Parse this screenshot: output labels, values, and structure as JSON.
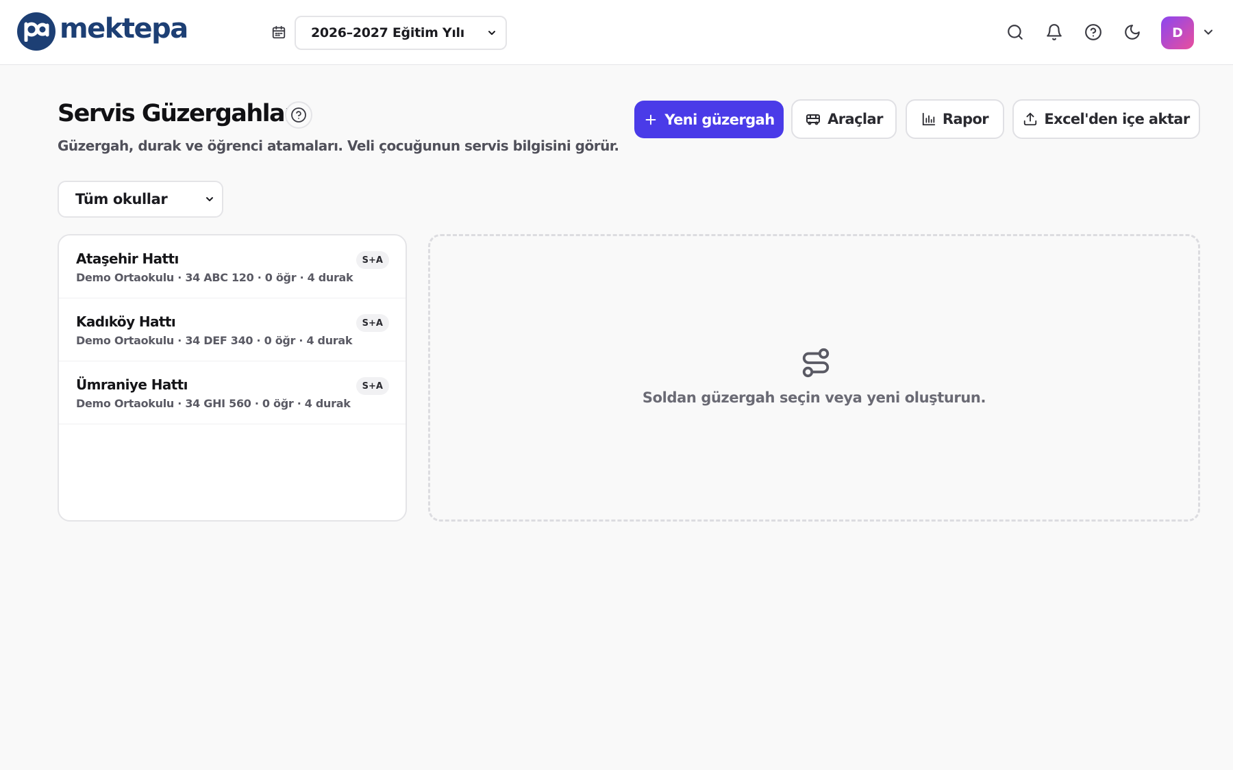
{
  "app": {
    "logo_text": "mektepa"
  },
  "topbar": {
    "year_select_value": "2026–2027 Eğitim Yılı",
    "avatar_initial": "D"
  },
  "header": {
    "title": "Servis Güzergahları",
    "subtitle": "Güzergah, durak ve öğrenci atamaları. Veli çocuğunun servis bilgisini görür.",
    "actions": {
      "new_route": "Yeni güzergah",
      "vehicles": "Araçlar",
      "report": "Rapor",
      "import_excel": "Excel'den içe aktar"
    }
  },
  "filters": {
    "school_select_value": "Tüm okullar"
  },
  "routes": [
    {
      "name": "Ataşehir Hattı",
      "meta": "Demo Ortaokulu · 34 ABC 120 · 0 öğr · 4 durak",
      "badge": "S+A"
    },
    {
      "name": "Kadıköy Hattı",
      "meta": "Demo Ortaokulu · 34 DEF 340 · 0 öğr · 4 durak",
      "badge": "S+A"
    },
    {
      "name": "Ümraniye Hattı",
      "meta": "Demo Ortaokulu · 34 GHI 560 · 0 öğr · 4 durak",
      "badge": "S+A"
    }
  ],
  "detail": {
    "empty_message": "Soldan güzergah seçin veya yeni oluşturun."
  },
  "colors": {
    "brand": "#1d3f74",
    "primary": "#4a3be8",
    "avatar_gradient_start": "#8b46f0",
    "avatar_gradient_end": "#e94f9c"
  }
}
